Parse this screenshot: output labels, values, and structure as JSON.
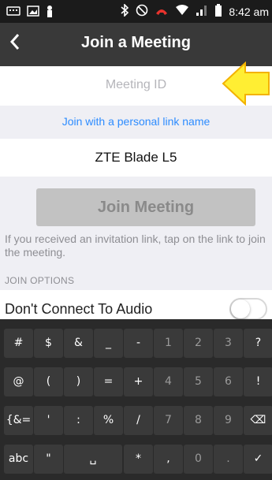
{
  "status": {
    "time": "8:42 am"
  },
  "header": {
    "title": "Join a Meeting",
    "back_icon": "chevron-left-icon"
  },
  "form": {
    "meeting_id_placeholder": "Meeting ID",
    "personal_link": "Join with a personal link name",
    "device_name": "ZTE Blade L5",
    "join_button": "Join Meeting",
    "hint": "If you received an invitation link, tap on the link to join the meeting."
  },
  "options": {
    "section_label": "JOIN OPTIONS",
    "audio_label": "Don't Connect To Audio",
    "audio_toggle_on": false
  },
  "keyboard": {
    "row1": [
      "#",
      "$",
      "&",
      "_",
      "-",
      "1",
      "2",
      "3",
      "?"
    ],
    "row2": [
      "@",
      "(",
      ")",
      "=",
      "+",
      "4",
      "5",
      "6",
      "!"
    ],
    "row3": [
      "{&=",
      "'",
      ":",
      "%",
      "/",
      "7",
      "8",
      "9",
      "⌫"
    ],
    "row4": [
      "abc",
      "\"",
      "␣",
      "*",
      ",",
      "0",
      ".",
      "✓"
    ]
  },
  "colors": {
    "accent": "#2d8cff",
    "arrow": "#ffee33",
    "arrow_outline": "#f3b200"
  }
}
